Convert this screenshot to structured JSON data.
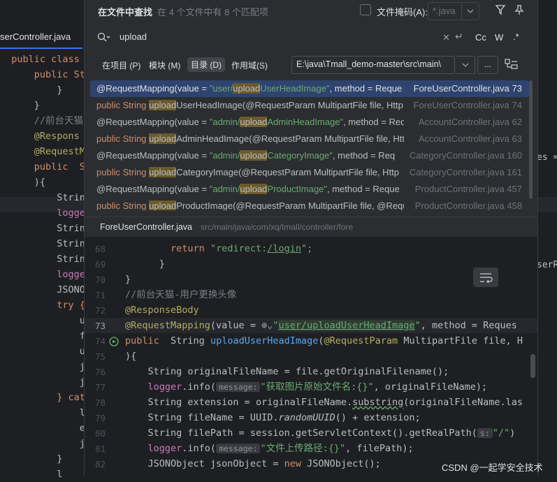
{
  "background_editor": {
    "tab_label": "serController.java",
    "lines": [
      {
        "text": "  public class",
        "style": "kw"
      },
      {
        "text": "      public St",
        "style": "kwmix"
      },
      {
        "text": "          }",
        "style": "plain"
      },
      {
        "text": "      }",
        "style": "plain"
      },
      {
        "text": "      //前台天猫",
        "style": "cm"
      },
      {
        "text": "      @Respons",
        "style": "ann"
      },
      {
        "text": "      @RequestM",
        "style": "ann"
      },
      {
        "text": "      public  S",
        "style": "kwmix"
      },
      {
        "text": "      ){",
        "style": "plain"
      },
      {
        "text": "          Strin",
        "style": "plain"
      },
      {
        "text": "          logge",
        "style": "fld"
      },
      {
        "text": "          Strin",
        "style": "plain"
      },
      {
        "text": "          Strin",
        "style": "plain"
      },
      {
        "text": "          Strin",
        "style": "plain"
      },
      {
        "text": "          logge",
        "style": "fld"
      },
      {
        "text": "          JSONO",
        "style": "plain"
      },
      {
        "text": "          try {",
        "style": "kw"
      },
      {
        "text": "              u",
        "style": "plain"
      },
      {
        "text": "              f",
        "style": "plain"
      },
      {
        "text": "              u",
        "style": "plain"
      },
      {
        "text": "              j",
        "style": "plain"
      },
      {
        "text": "              j",
        "style": "plain"
      },
      {
        "text": "          } cat",
        "style": "kw"
      },
      {
        "text": "              l",
        "style": "plain"
      },
      {
        "text": "              e",
        "style": "plain"
      },
      {
        "text": "              j",
        "style": "plain"
      },
      {
        "text": "          }",
        "style": "plain"
      },
      {
        "text": "          l",
        "style": "plain"
      }
    ],
    "right_fragments": {
      "line_1": "es =",
      "line_2": "serR"
    }
  },
  "popup": {
    "title": "在文件中查找",
    "count_text": "在 4 个文件中有 8 个匹配项",
    "file_mask_label": "文件掩码(A):",
    "file_mask_value": "*.java",
    "search_query": "upload",
    "toggles": {
      "case": "Cc",
      "word": "W",
      "regex": ".*"
    },
    "scope_tabs": [
      {
        "label": "在项目 (P)",
        "active": false
      },
      {
        "label": "模块 (M)",
        "active": false
      },
      {
        "label": "目录 (D)",
        "active": true
      },
      {
        "label": "作用域(S)",
        "active": false
      }
    ],
    "directory": "E:\\java\\Tmall_demo-master\\src\\main\\",
    "browse_label": "...",
    "results": [
      {
        "pre": "@RequestMapping(value = ",
        "str_pre": "\"user/",
        "match": "upload",
        "str_post": "UserHeadImage\"",
        "post": ", method = Reque",
        "file": "ForeUserController.java 73",
        "selected": true
      },
      {
        "pre": "public  String ",
        "str_pre": "",
        "match": "upload",
        "str_post": "",
        "post": "UserHeadImage(@RequestParam MultipartFile file, Http",
        "file": "ForeUserController.java 74",
        "selected": false
      },
      {
        "pre": "@RequestMapping(value = ",
        "str_pre": "\"admin/",
        "match": "upload",
        "str_post": "AdminHeadImage\"",
        "post": ", method = Req",
        "file": "AccountController.java 62",
        "selected": false
      },
      {
        "pre": "public String ",
        "str_pre": "",
        "match": "upload",
        "str_post": "",
        "post": "AdminHeadImage(@RequestParam MultipartFile file, Http",
        "file": "AccountController.java 63",
        "selected": false
      },
      {
        "pre": "@RequestMapping(value = ",
        "str_pre": "\"admin/",
        "match": "upload",
        "str_post": "CategoryImage\"",
        "post": ", method = Req",
        "file": "CategoryController.java 160",
        "selected": false
      },
      {
        "pre": "public String ",
        "str_pre": "",
        "match": "upload",
        "str_post": "",
        "post": "CategoryImage(@RequestParam MultipartFile file, Http",
        "file": "CategoryController.java 161",
        "selected": false
      },
      {
        "pre": "@RequestMapping(value = ",
        "str_pre": "\"admin/",
        "match": "upload",
        "str_post": "ProductImage\"",
        "post": ", method = Reque",
        "file": "ProductController.java 457",
        "selected": false
      },
      {
        "pre": "public String ",
        "str_pre": "",
        "match": "upload",
        "str_post": "",
        "post": "ProductImage(@RequestParam MultipartFile file, @Requ",
        "file": "ProductController.java 458",
        "selected": false
      }
    ],
    "preview_file": "ForeUserController.java",
    "preview_path": "src/main/java/com/xq/tmall/controller/fore",
    "line_numbers": [
      "68",
      "69",
      "70",
      "71",
      "72",
      "73",
      "74",
      "75",
      "76",
      "77",
      "78",
      "79",
      "80",
      "81",
      "82"
    ],
    "code": {
      "l68_kw": "return",
      "l68_str": "\"redirect:",
      "l68_link": "/login",
      "l68_end": "\";",
      "l69": "}",
      "l70": "}",
      "l71": "//前台天猫-用户更换头像",
      "l72": "@ResponseBody",
      "l73_ann": "@RequestMapping",
      "l73_a": "(value = ",
      "l73_icon": "⊕⌄",
      "l73_q": "\"",
      "l73_link": "user/uploadUserHeadImage",
      "l73_q2": "\"",
      "l73_b": ", method = Reques",
      "l74_kw": "public",
      "l74_a": "  String ",
      "l74_fn": "uploadUserHeadImage",
      "l74_b": "(",
      "l74_ann": "@RequestParam",
      "l74_c": " MultipartFile file, H",
      "l75": "){",
      "l76": "String originalFileName = file.getOriginalFilename();",
      "l77_fld": "logger",
      "l77_a": ".info(",
      "l77_hint": "message:",
      "l77_str": "\"获取图片原始文件名:{}\"",
      "l77_b": ", originalFileName);",
      "l78_a": "String extension = originalFileName.",
      "l78_sq": "substring",
      "l78_b": "(originalFileName.las",
      "l79_a": "String fileName = UUID.",
      "l79_it": "randomUUID",
      "l79_b": "() + extension;",
      "l80_a": "String filePath = session.getServletContext().getRealPath(",
      "l80_hint": "s:",
      "l80_str": "\"/\"",
      "l80_b": ")",
      "l81_fld": "logger",
      "l81_a": ".info(",
      "l81_hint": "message:",
      "l81_str": "\"文件上传路径:{}\"",
      "l81_b": ", filePath);",
      "l82_a": "JSONObject jsonObject = ",
      "l82_kw": "new",
      "l82_b": " JSONObject();"
    }
  },
  "watermark": "CSDN @一起学安全技术",
  "icons": [
    "search-icon",
    "clear-icon",
    "newline-icon",
    "filter-icon",
    "pin-icon",
    "tree-view-icon",
    "chevron-down-icon",
    "soft-wrap-icon",
    "run-gutter-icon",
    "globe-icon"
  ],
  "colors": {
    "selection": "#2e436e",
    "match_highlight": "#6b5a2b",
    "keyword": "#cf8e6d",
    "string": "#6aab73",
    "annotation": "#b3ae60",
    "function": "#56a8f5",
    "field": "#c77dbb"
  }
}
